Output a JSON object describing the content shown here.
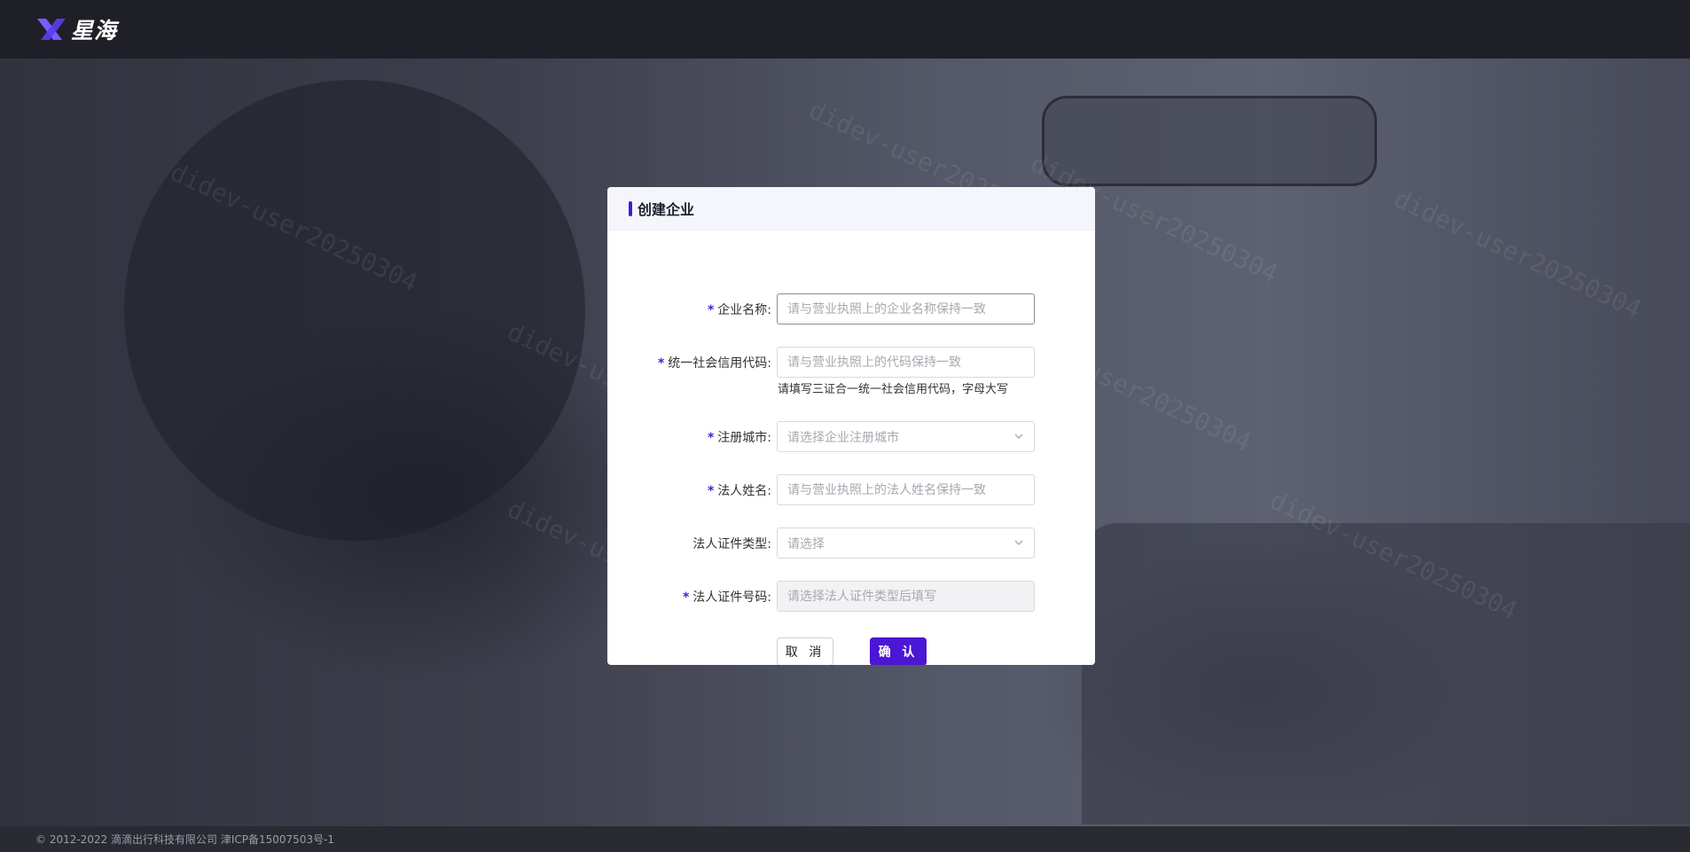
{
  "header": {
    "brand": "星海"
  },
  "modal": {
    "title": "创建企业",
    "fields": {
      "company_name": {
        "label": "企业名称:",
        "required_mark": "*",
        "placeholder": "请与营业执照上的企业名称保持一致"
      },
      "credit_code": {
        "label": "统一社会信用代码:",
        "required_mark": "*",
        "placeholder": "请与营业执照上的代码保持一致",
        "hint": "请填写三证合一统一社会信用代码，字母大写"
      },
      "city": {
        "label": "注册城市:",
        "required_mark": "*",
        "placeholder": "请选择企业注册城市"
      },
      "legal_name": {
        "label": "法人姓名:",
        "required_mark": "*",
        "placeholder": "请与营业执照上的法人姓名保持一致"
      },
      "id_type": {
        "label": "法人证件类型:",
        "placeholder": "请选择"
      },
      "id_number": {
        "label": "法人证件号码:",
        "required_mark": "*",
        "placeholder": "请选择法人证件类型后填写"
      }
    },
    "buttons": {
      "cancel": "取 消",
      "confirm": "确 认"
    }
  },
  "footer": {
    "copyright": "© 2012-2022 滴滴出行科技有限公司 津ICP备15007503号-1"
  },
  "watermark": "didev-user20250304",
  "colors": {
    "accent": "#4b16d4",
    "topbar": "#1f1f27",
    "footer": "#2a2a33"
  }
}
